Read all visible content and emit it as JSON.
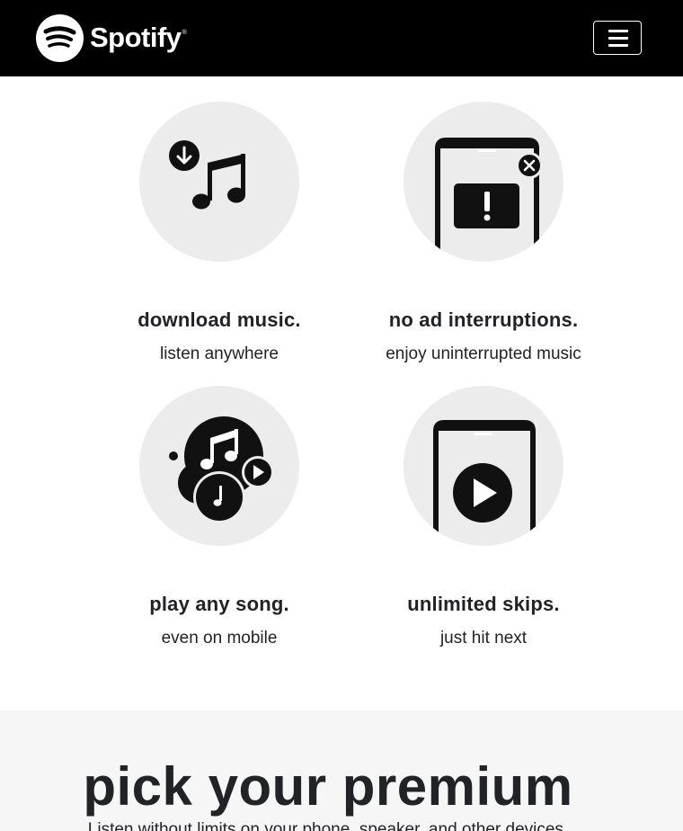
{
  "brand": {
    "name": "Spotify",
    "registered_mark": "®"
  },
  "nav": {
    "menu_icon": "hamburger-menu-icon"
  },
  "features": [
    {
      "icon": "download-music-icon",
      "title": "download music.",
      "subtitle": "listen anywhere"
    },
    {
      "icon": "no-ads-icon",
      "title": "no ad interruptions.",
      "subtitle": "enjoy uninterrupted music"
    },
    {
      "icon": "play-any-song-icon",
      "title": "play any song.",
      "subtitle": "even on mobile"
    },
    {
      "icon": "unlimited-skips-icon",
      "title": "unlimited skips.",
      "subtitle": "just hit next"
    }
  ],
  "premium": {
    "heading": "pick your premium",
    "subtext": "Listen without limits on your phone, speaker, and other devices."
  },
  "colors": {
    "navbar": "#000000",
    "circle": "#ececec",
    "text": "#222326",
    "section_bg": "#f6f6f6"
  }
}
